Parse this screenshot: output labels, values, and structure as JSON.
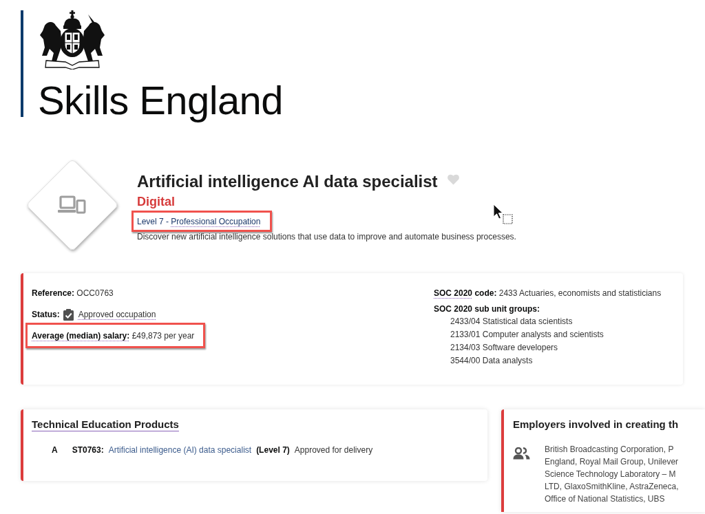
{
  "header": {
    "brand": "Skills England"
  },
  "occupation": {
    "title": "Artificial intelligence AI data specialist",
    "favourite": false,
    "route": "Digital",
    "level": {
      "prefix": "Level 7 -",
      "link": "Professional Occupation",
      "highlighted": true
    },
    "description": "Discover new artificial intelligence solutions that use data to improve and automate business processes."
  },
  "summary": {
    "details": [
      {
        "kind": "text",
        "label": "Reference:",
        "value": "OCC0763",
        "highlighted": false
      },
      {
        "kind": "status",
        "label": "Status:",
        "value": "Approved occupation",
        "highlighted": false
      },
      {
        "kind": "term",
        "label": "Average (median) salary:",
        "value": "£49,873 per year",
        "highlighted": true
      }
    ],
    "soc_code": {
      "term": "SOC 2020",
      "label": "code:",
      "value": "2433 Actuaries, economists and statisticians"
    },
    "sub_unit_groups": {
      "heading": "SOC 2020 sub unit groups:",
      "items": [
        "2433/04 Statistical data scientists",
        "2133/01 Computer analysts and scientists",
        "2134/03 Software developers",
        "3544/00 Data analysts"
      ]
    }
  },
  "products": {
    "title": "Technical Education Products",
    "rows": [
      {
        "letter": "A",
        "code": "ST0763:",
        "name": "Artificial intelligence (AI) data specialist",
        "level_text": "(Level 7)",
        "status": "Approved for delivery"
      }
    ]
  },
  "employers": {
    "title": "Employers involved in creating th",
    "lines": [
      "British Broadcasting Corporation, P",
      "England, Royal Mail Group, Unilever",
      "Science Technology Laboratory – M",
      "LTD, GlaxoSmithKline, AstraZeneca,",
      "Office of National Statistics, UBS"
    ]
  }
}
